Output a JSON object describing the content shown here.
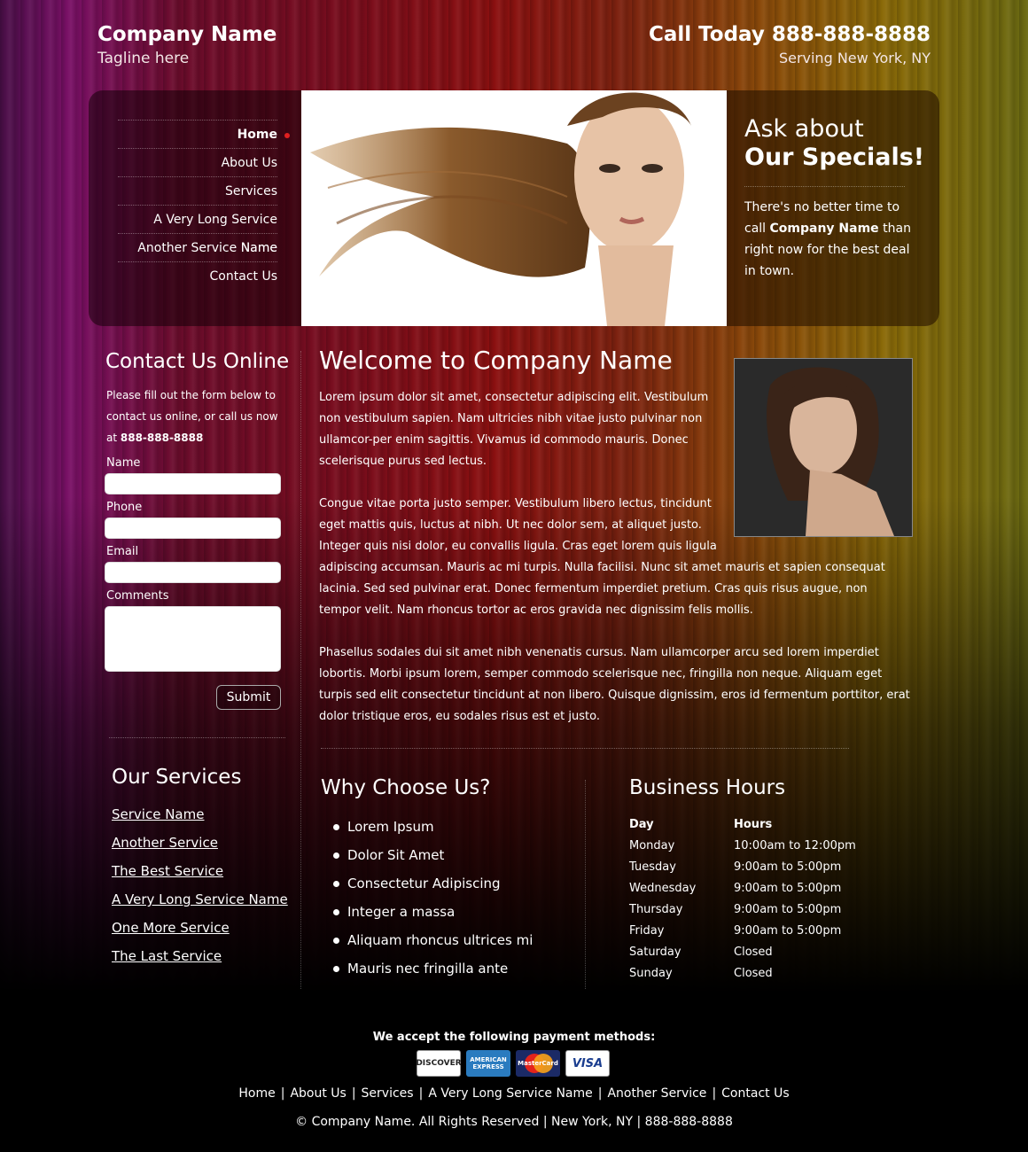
{
  "header": {
    "company_name": "Company Name",
    "tagline": "Tagline here",
    "call": "Call Today 888-888-8888",
    "serving": "Serving New York, NY"
  },
  "nav": {
    "items": [
      {
        "label": "Home",
        "active": true
      },
      {
        "label": "About Us",
        "active": false
      },
      {
        "label": "Services",
        "active": false
      },
      {
        "label": "A Very Long Service Name",
        "active": false
      },
      {
        "label": "Another Service Name",
        "active": false
      },
      {
        "label": "Contact Us",
        "active": false
      }
    ]
  },
  "specials": {
    "line1": "Ask about",
    "line2": "Our Specials!",
    "text_before": "There's no better time to call ",
    "text_bold": "Company Name",
    "text_after": " than right now for the best deal in town."
  },
  "contact": {
    "title": "Contact Us Online",
    "intro": "Please fill out the form below to contact us online, or call us now at ",
    "phone": "888-888-8888",
    "name_label": "Name",
    "phone_label": "Phone",
    "email_label": "Email",
    "comments_label": "Comments",
    "submit": "Submit"
  },
  "services": {
    "title": "Our Services",
    "items": [
      "Service Name",
      "Another Service",
      "The Best Service",
      "A Very Long Service Name",
      "One More Service",
      "The Last Service"
    ]
  },
  "welcome": {
    "title": "Welcome to Company Name",
    "p1": "Lorem ipsum dolor sit amet, consectetur adipiscing elit. Vestibulum non vestibulum sapien. Nam ultricies nibh vitae justo pulvinar non ullamcor-per enim sagittis. Vivamus id commodo mauris. Donec scelerisque purus sed lectus.",
    "p2": "Congue vitae porta justo semper. Vestibulum libero lectus, tincidunt eget mattis quis, luctus at nibh. Ut nec dolor sem, at aliquet justo. Integer quis nisi dolor, eu convallis ligula. Cras eget lorem quis ligula adipiscing accumsan. Mauris ac mi turpis. Nulla facilisi. Nunc sit amet mauris et sapien consequat lacinia. Sed sed pulvinar erat. Donec fermentum imperdiet pretium. Cras quis risus augue, non tempor velit. Nam rhoncus tortor ac eros gravida nec dignissim felis mollis.",
    "p3": "Phasellus sodales dui sit amet nibh venenatis cursus. Nam ullamcorper arcu sed lorem imperdiet lobortis. Morbi ipsum lorem, semper commodo scelerisque nec, fringilla non neque. Aliquam eget turpis sed elit consectetur tincidunt at non libero. Quisque dignissim, eros id fermentum porttitor, erat dolor tristique eros, eu sodales risus est et justo."
  },
  "why": {
    "title": "Why Choose Us?",
    "items": [
      "Lorem Ipsum",
      "Dolor Sit Amet",
      "Consectetur Adipiscing",
      "Integer a massa",
      "Aliquam rhoncus ultrices mi",
      "Mauris nec fringilla ante"
    ]
  },
  "hours": {
    "title": "Business Hours",
    "col_day": "Day",
    "col_hours": "Hours",
    "rows": [
      {
        "day": "Monday",
        "hours": "10:00am to 12:00pm"
      },
      {
        "day": "Tuesday",
        "hours": "9:00am to 5:00pm"
      },
      {
        "day": "Wednesday",
        "hours": "9:00am to 5:00pm"
      },
      {
        "day": "Thursday",
        "hours": "9:00am to 5:00pm"
      },
      {
        "day": "Friday",
        "hours": "9:00am to 5:00pm"
      },
      {
        "day": "Saturday",
        "hours": "Closed"
      },
      {
        "day": "Sunday",
        "hours": "Closed"
      }
    ]
  },
  "footer": {
    "payment_title": "We accept the following payment methods:",
    "cards": {
      "discover": "DISCOVER",
      "amex": "AMERICAN EXPRESS",
      "mastercard": "MasterCard",
      "visa": "VISA"
    },
    "links": [
      "Home",
      "About Us",
      "Services",
      "A Very Long Service Name",
      "Another Service",
      "Contact Us"
    ],
    "separator": "|",
    "copyright": "© Company Name. All Rights Reserved | New York, NY | 888-888-8888"
  }
}
